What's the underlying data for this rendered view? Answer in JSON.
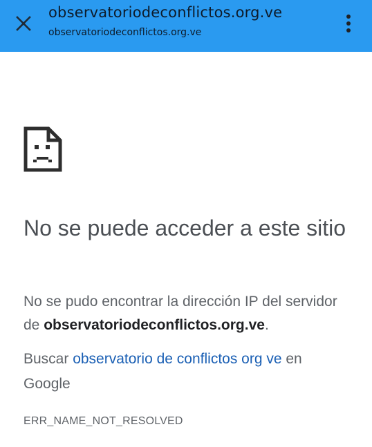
{
  "toolbar": {
    "title": "observatoriodeconflictos.org.ve",
    "url": "observatoriodeconflictos.org.ve",
    "close_icon": "close-icon",
    "menu_icon": "more-vert-icon",
    "accent_color": "#2a9af0"
  },
  "error": {
    "icon": "sad-page-icon",
    "headline": "No se puede acceder a este sitio",
    "desc_prefix": "No se pudo encontrar la dirección IP del servidor de ",
    "domain": "observatoriodeconflictos.org.ve",
    "desc_suffix": ".",
    "search_prefix": "Buscar ",
    "search_link": "observatorio de conflictos org ve",
    "search_suffix": " en Google",
    "code": "ERR_NAME_NOT_RESOLVED",
    "link_color": "#1a5fb4"
  }
}
